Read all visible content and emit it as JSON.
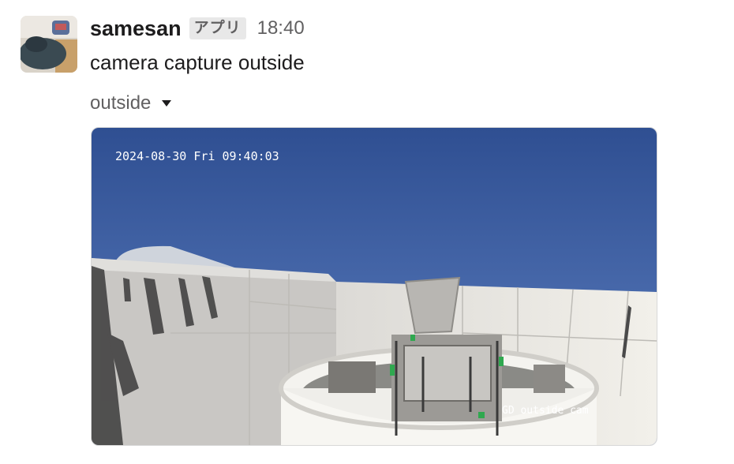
{
  "message": {
    "author": "samesan",
    "app_badge": "アプリ",
    "time": "18:40",
    "text": "camera capture outside",
    "avatar_icon": "user-avatar-photo"
  },
  "attachment": {
    "name": "outside",
    "toggle_icon": "caret-down-icon",
    "image": {
      "overlay_timestamp": "2024-08-30 Fri 09:40:03",
      "overlay_label": "GD outside cam",
      "sky_color": "#3a5aa0",
      "scene_icon": "observatory-camera-photo"
    }
  }
}
